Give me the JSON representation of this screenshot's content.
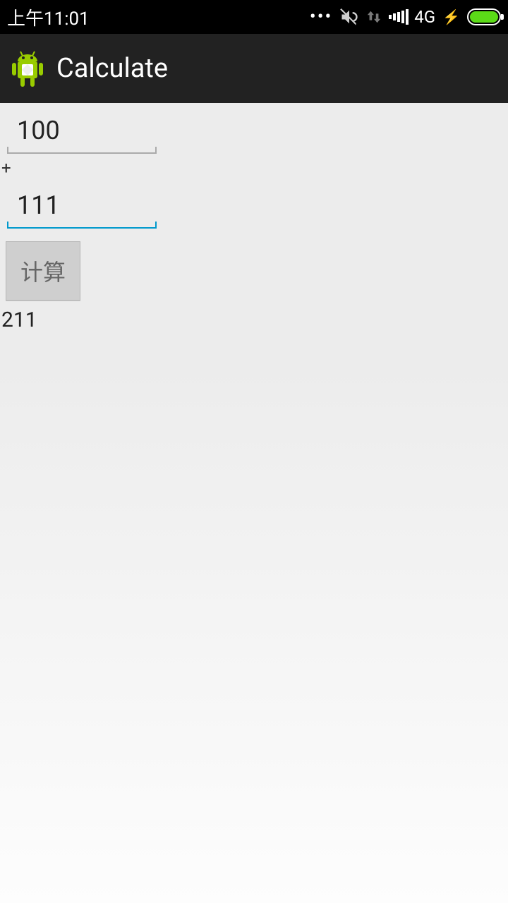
{
  "status_bar": {
    "time": "上午11:01",
    "network_label": "4G"
  },
  "app_bar": {
    "title": "Calculate"
  },
  "main": {
    "operand1": "100",
    "operator": "+",
    "operand2": "111",
    "button_label": "计算",
    "result": "211"
  }
}
